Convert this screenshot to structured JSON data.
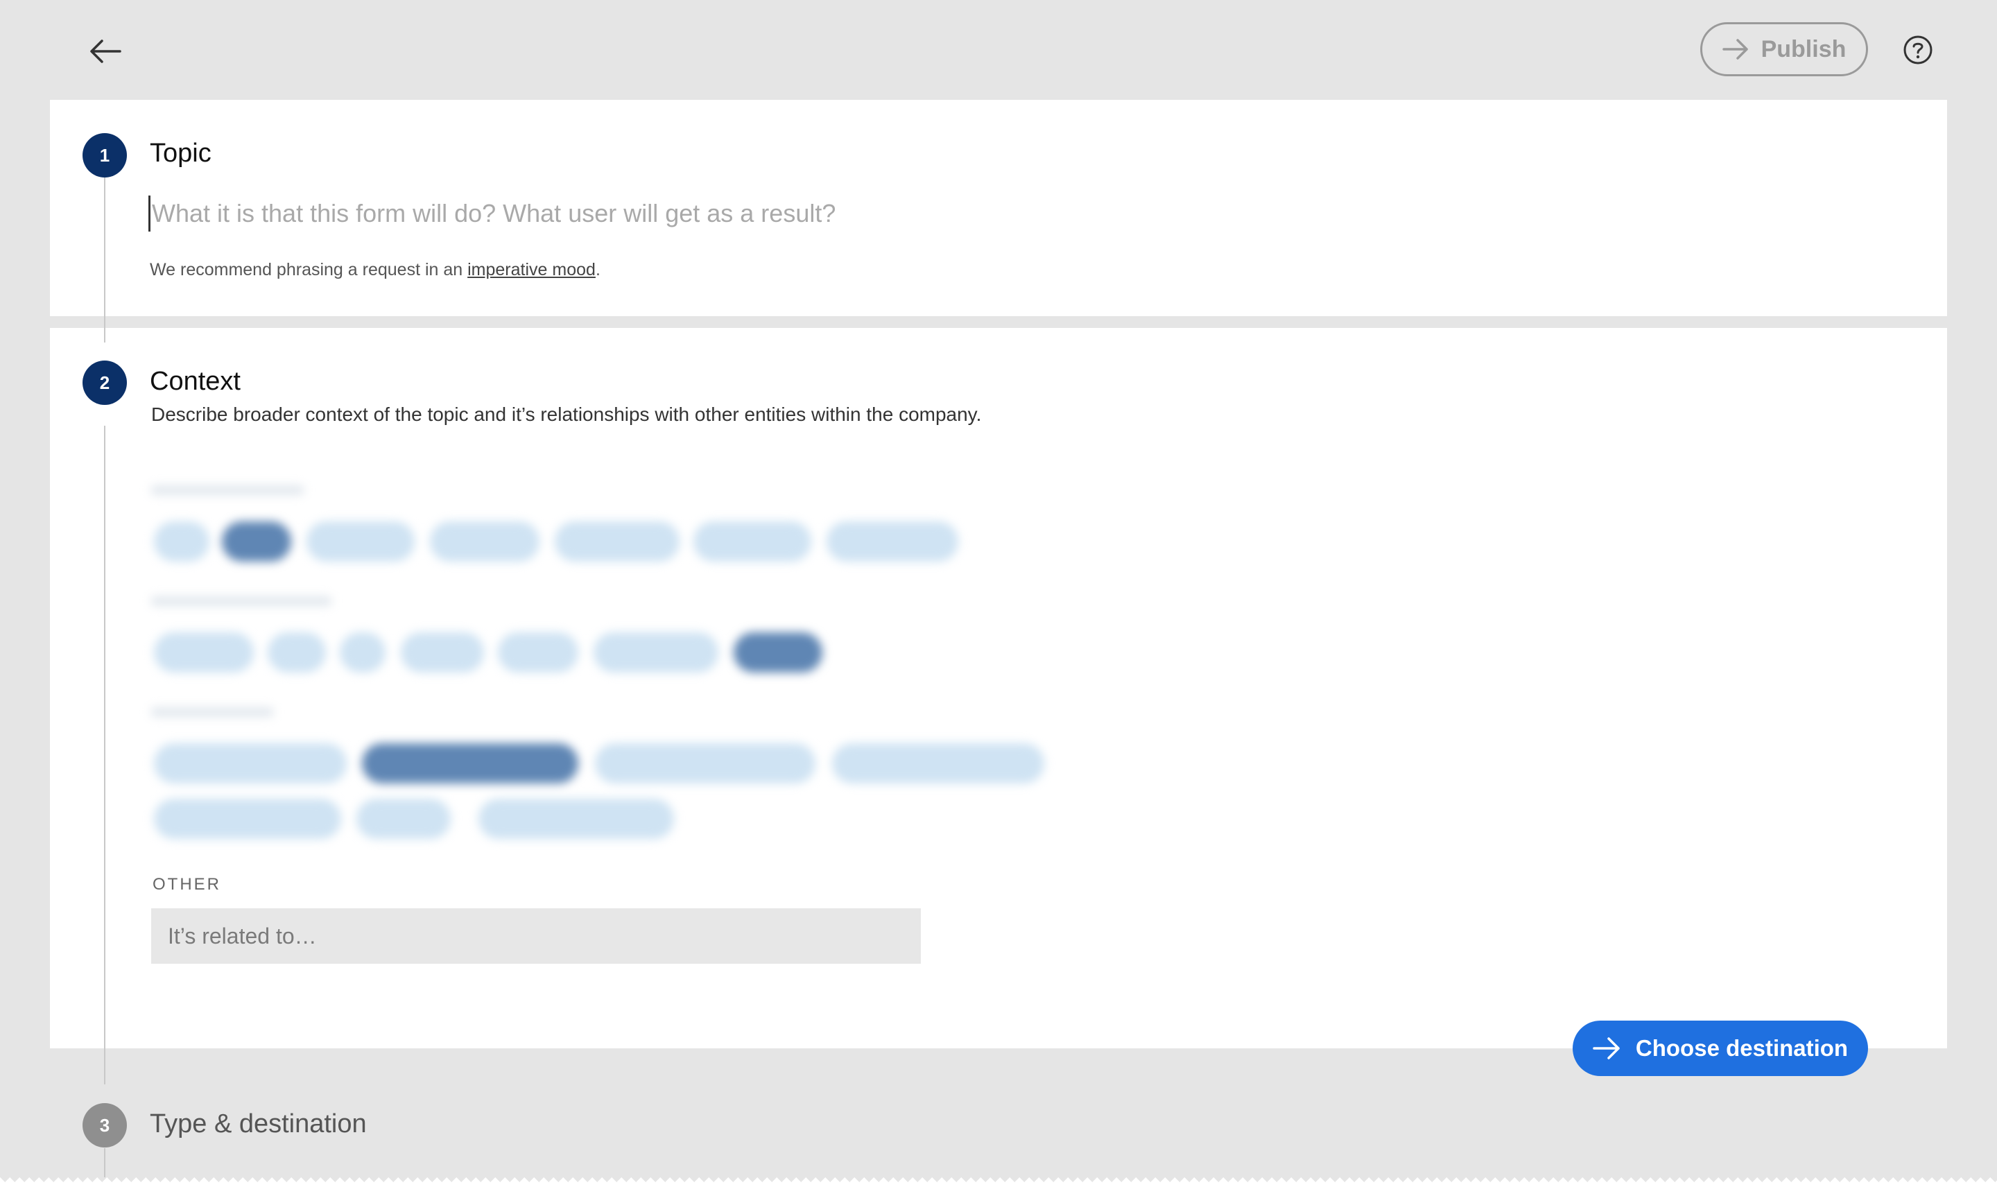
{
  "topbar": {
    "back_icon": "arrow-left-icon",
    "publish_label": "Publish",
    "publish_icon": "arrow-right-icon",
    "help_icon": "question-circle-icon"
  },
  "steps": [
    {
      "number": "1",
      "title": "Topic",
      "input_placeholder": "What it is that this form will do? What user will get as a result?",
      "hint_prefix": "We recommend phrasing a request in an ",
      "hint_link": "imperative mood",
      "hint_suffix": "."
    },
    {
      "number": "2",
      "title": "Context",
      "description": "Describe broader context of the topic and it’s relationships with other entities within the company.",
      "other_label": "OTHER",
      "other_placeholder": "It’s related to…"
    },
    {
      "number": "3",
      "title": "Type & destination"
    }
  ],
  "actions": {
    "choose_destination_label": "Choose destination",
    "choose_destination_icon": "arrow-right-icon"
  },
  "colors": {
    "step_active": "#0b3068",
    "step_muted": "#8f8f8f",
    "primary_button": "#1f70e0",
    "chip": "#cfe3f3",
    "chip_selected": "#5f86b4"
  }
}
